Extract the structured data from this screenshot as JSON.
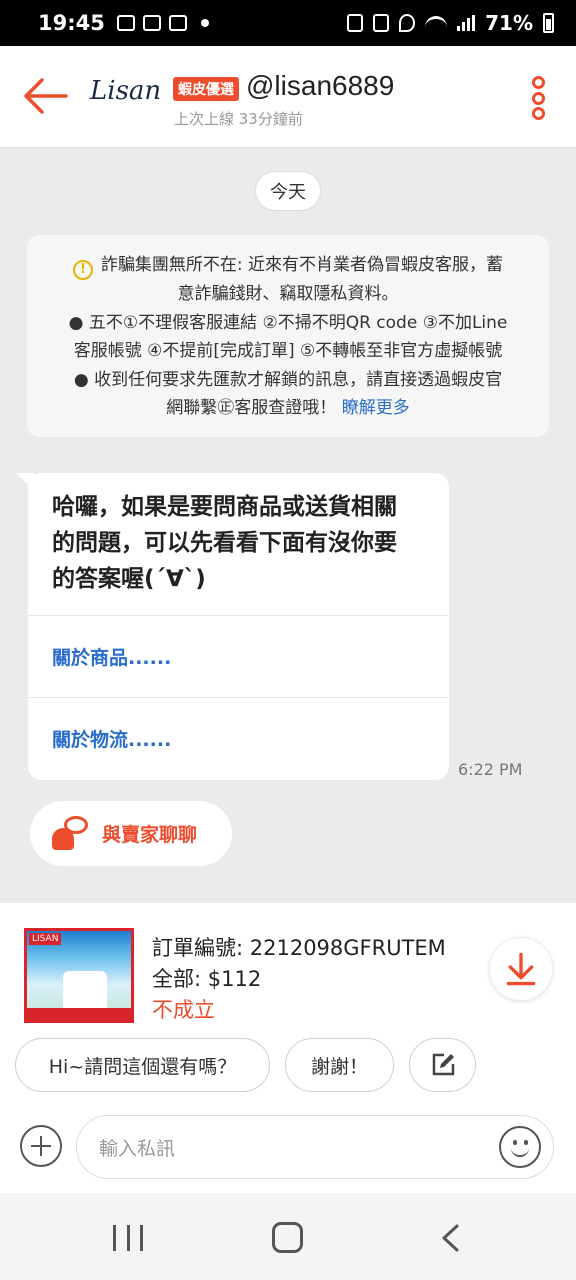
{
  "status_bar": {
    "time": "19:45",
    "battery": "71%"
  },
  "header": {
    "seller_logo": "Lisan",
    "badge": "蝦皮優選",
    "username": "@lisan6889",
    "last_seen": "上次上線 33分鐘前"
  },
  "chat": {
    "date_pill": "今天",
    "notice": {
      "line1": "詐騙集團無所不在: 近來有不肖業者偽冒蝦皮客服，蓄",
      "line2": "意詐騙錢財、竊取隱私資料。",
      "line3": "● 五不①不理假客服連結 ②不掃不明QR code ③不加Line",
      "line4": "客服帳號 ④不提前[完成訂單] ⑤不轉帳至非官方虛擬帳號",
      "line5": "● 收到任何要求先匯款才解鎖的訊息，請直接透過蝦皮官",
      "line6": "網聯繫㊣客服查證哦！",
      "link": "瞭解更多"
    },
    "bot_message": {
      "text_line1": "哈囉，如果是要問商品或送貨相關",
      "text_line2": "的問題，可以先看看下面有沒你要",
      "text_line3": "的答案喔(ˊ∀ˋ)",
      "option1": "關於商品......",
      "option2": "關於物流......"
    },
    "timestamp": "6:22 PM",
    "chat_with_seller": "與賣家聊聊"
  },
  "order": {
    "number": "訂單編號: 2212098GFRUTEM",
    "total": "全部: $112",
    "status": "不成立",
    "thumbnail_tag": "LISAN"
  },
  "quick_replies": [
    "Hi~請問這個還有嗎？",
    "謝謝！"
  ],
  "input": {
    "placeholder": "輸入私訊"
  },
  "colors": {
    "accent": "#ee4d2d",
    "link": "#2a6ecb",
    "background": "#ebebeb"
  },
  "icons": [
    "back-arrow-icon",
    "more-vertical-icon",
    "warning-icon",
    "chat-seller-icon",
    "download-icon",
    "edit-icon",
    "plus-icon",
    "emoji-icon",
    "nav-recent-icon",
    "nav-home-icon",
    "nav-back-icon"
  ]
}
